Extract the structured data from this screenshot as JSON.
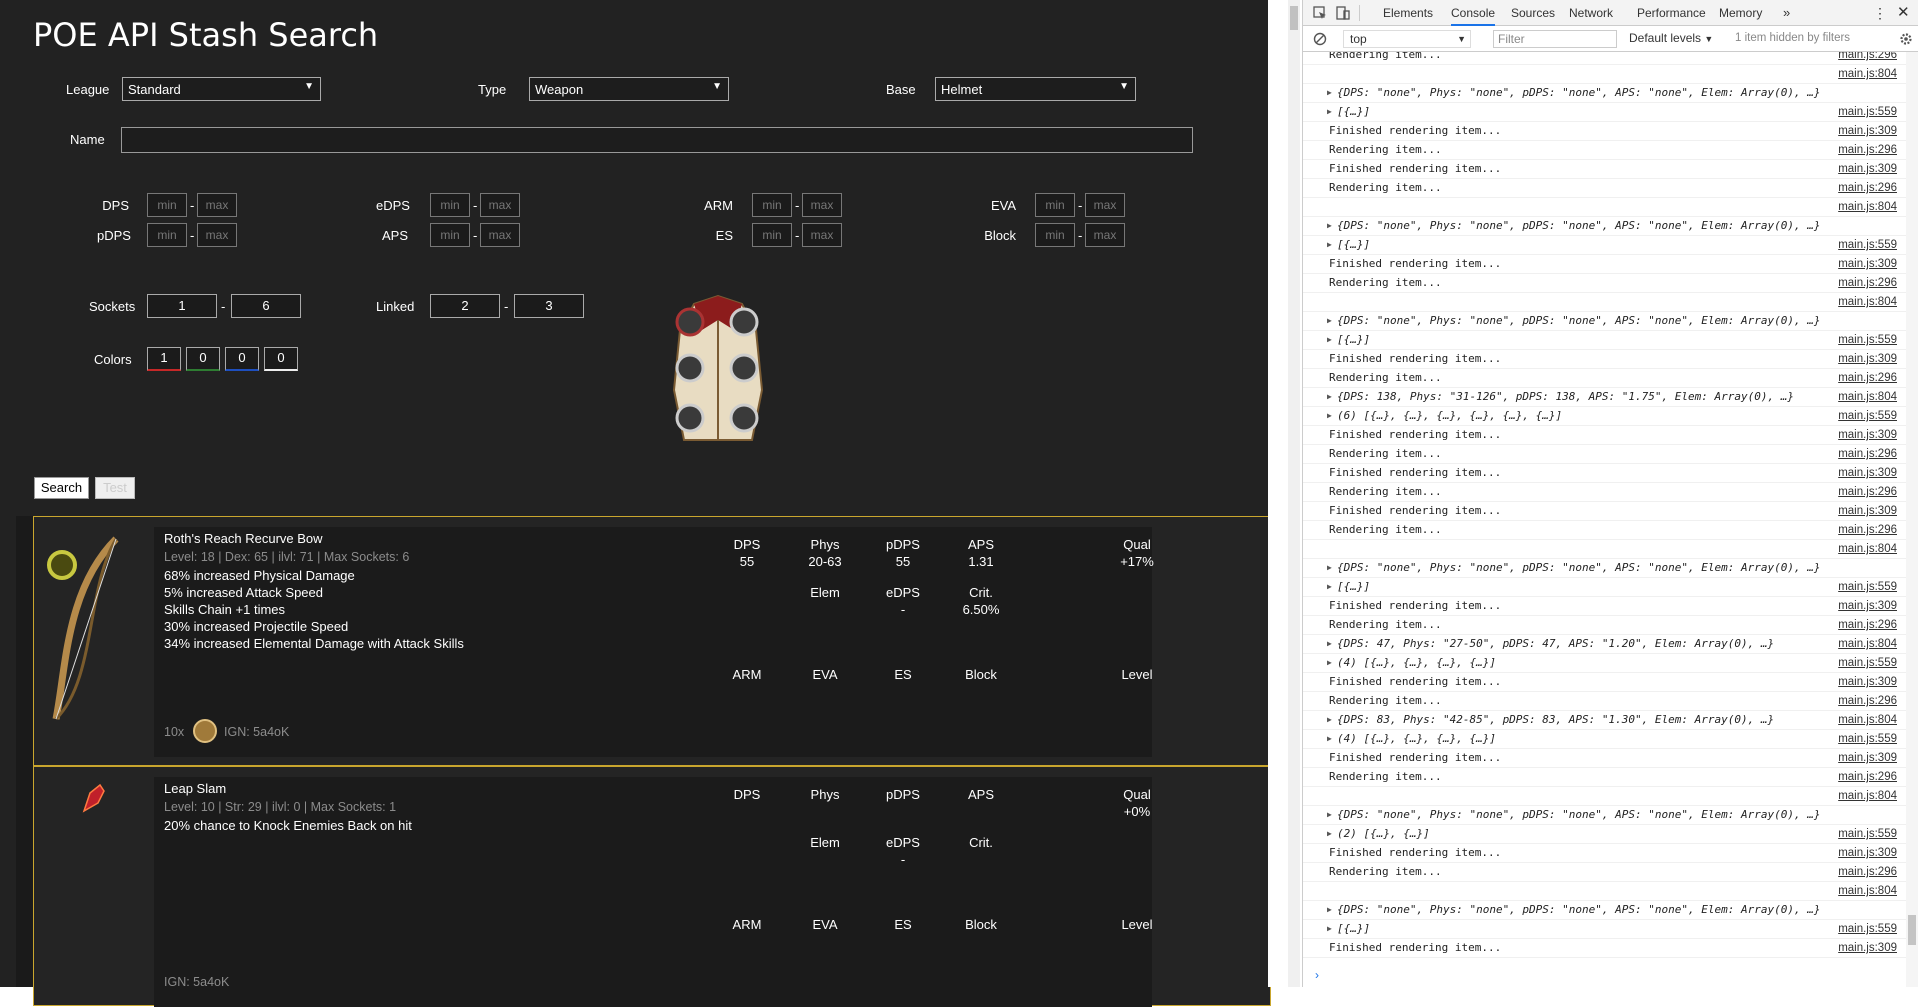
{
  "app": {
    "title": "POE API Stash Search"
  },
  "form": {
    "league_label": "League",
    "league_value": "Standard",
    "type_label": "Type",
    "type_value": "Weapon",
    "base_label": "Base",
    "base_value": "Helmet",
    "name_label": "Name",
    "min_placeholder": "min",
    "max_placeholder": "max",
    "stats_left": [
      "DPS",
      "pDPS"
    ],
    "stats_mid": [
      "eDPS",
      "APS"
    ],
    "stats_right": [
      "ARM",
      "ES"
    ],
    "stats_far": [
      "EVA",
      "Block"
    ],
    "sockets_label": "Sockets",
    "sockets_min": "1",
    "sockets_max": "6",
    "linked_label": "Linked",
    "linked_min": "2",
    "linked_max": "3",
    "colors_label": "Colors",
    "colors": [
      {
        "value": "1",
        "color": "#c62828"
      },
      {
        "value": "0",
        "color": "#2e7d32"
      },
      {
        "value": "0",
        "color": "#1e4fbf"
      },
      {
        "value": "0",
        "color": "#eeeeee"
      }
    ],
    "search_button": "Search",
    "test_button": "Test"
  },
  "results": [
    {
      "name": "Roth's Reach Recurve Bow",
      "meta": "Level: 18 | Dex: 65 | ilvl: 71 | Max Sockets: 6",
      "mods": [
        "68% increased Physical Damage",
        "5% increased Attack Speed",
        "Skills Chain +1 times",
        "30% increased Projectile Speed",
        "34% increased Elemental Damage with Attack Skills"
      ],
      "stats": {
        "dps_h": "DPS",
        "dps": "55",
        "phys_h": "Phys",
        "phys": "20-63",
        "pdps_h": "pDPS",
        "pdps": "55",
        "aps_h": "APS",
        "aps": "1.31",
        "qual_h": "Qual",
        "qual": "+17%",
        "elem_h": "Elem",
        "elem": "",
        "edps_h": "eDPS",
        "edps": "-",
        "crit_h": "Crit.",
        "crit": "6.50%",
        "arm_h": "ARM",
        "eva_h": "EVA",
        "es_h": "ES",
        "block_h": "Block",
        "level_h": "Level"
      },
      "footer_qty": "10x",
      "footer_ign": "IGN: 5a4oK"
    },
    {
      "name": "Leap Slam",
      "meta": "Level: 10 | Str: 29 | ilvl: 0 | Max Sockets: 1",
      "mods": [
        "20% chance to Knock Enemies Back on hit"
      ],
      "stats": {
        "dps_h": "DPS",
        "phys_h": "Phys",
        "pdps_h": "pDPS",
        "aps_h": "APS",
        "qual_h": "Qual",
        "qual": "+0%",
        "elem_h": "Elem",
        "edps_h": "eDPS",
        "edps": "-",
        "crit_h": "Crit.",
        "arm_h": "ARM",
        "eva_h": "EVA",
        "es_h": "ES",
        "block_h": "Block",
        "level_h": "Level"
      },
      "footer_ign": "IGN: 5a4oK"
    }
  ],
  "devtools": {
    "tabs": [
      "Elements",
      "Console",
      "Sources",
      "Network",
      "Performance",
      "Memory"
    ],
    "active_tab": "Console",
    "context": "top",
    "filter_placeholder": "Filter",
    "levels": "Default levels",
    "hidden_note": "1 item hidden by filters",
    "logs": [
      {
        "msg": "Rendering item...",
        "src": "main.js:296",
        "kind": "text"
      },
      {
        "msg": "",
        "src": "main.js:804",
        "kind": "text"
      },
      {
        "msg": "{DPS: \"none\", Phys: \"none\", pDPS: \"none\", APS: \"none\", Elem: Array(0), …}",
        "src": "",
        "kind": "obj"
      },
      {
        "msg": "[{…}]",
        "src": "main.js:559",
        "kind": "obj"
      },
      {
        "msg": "Finished rendering item...",
        "src": "main.js:309",
        "kind": "text"
      },
      {
        "msg": "Rendering item...",
        "src": "main.js:296",
        "kind": "text"
      },
      {
        "msg": "Finished rendering item...",
        "src": "main.js:309",
        "kind": "text"
      },
      {
        "msg": "Rendering item...",
        "src": "main.js:296",
        "kind": "text"
      },
      {
        "msg": "",
        "src": "main.js:804",
        "kind": "text"
      },
      {
        "msg": "{DPS: \"none\", Phys: \"none\", pDPS: \"none\", APS: \"none\", Elem: Array(0), …}",
        "src": "",
        "kind": "obj"
      },
      {
        "msg": "[{…}]",
        "src": "main.js:559",
        "kind": "obj"
      },
      {
        "msg": "Finished rendering item...",
        "src": "main.js:309",
        "kind": "text"
      },
      {
        "msg": "Rendering item...",
        "src": "main.js:296",
        "kind": "text"
      },
      {
        "msg": "",
        "src": "main.js:804",
        "kind": "text"
      },
      {
        "msg": "{DPS: \"none\", Phys: \"none\", pDPS: \"none\", APS: \"none\", Elem: Array(0), …}",
        "src": "",
        "kind": "obj"
      },
      {
        "msg": "[{…}]",
        "src": "main.js:559",
        "kind": "obj"
      },
      {
        "msg": "Finished rendering item...",
        "src": "main.js:309",
        "kind": "text"
      },
      {
        "msg": "Rendering item...",
        "src": "main.js:296",
        "kind": "text"
      },
      {
        "msg": "{DPS: 138, Phys: \"31-126\", pDPS: 138, APS: \"1.75\", Elem: Array(0), …}",
        "src": "main.js:804",
        "kind": "obj"
      },
      {
        "msg": "(6) [{…}, {…}, {…}, {…}, {…}, {…}]",
        "src": "main.js:559",
        "kind": "obj"
      },
      {
        "msg": "Finished rendering item...",
        "src": "main.js:309",
        "kind": "text"
      },
      {
        "msg": "Rendering item...",
        "src": "main.js:296",
        "kind": "text"
      },
      {
        "msg": "Finished rendering item...",
        "src": "main.js:309",
        "kind": "text"
      },
      {
        "msg": "Rendering item...",
        "src": "main.js:296",
        "kind": "text"
      },
      {
        "msg": "Finished rendering item...",
        "src": "main.js:309",
        "kind": "text"
      },
      {
        "msg": "Rendering item...",
        "src": "main.js:296",
        "kind": "text"
      },
      {
        "msg": "",
        "src": "main.js:804",
        "kind": "text"
      },
      {
        "msg": "{DPS: \"none\", Phys: \"none\", pDPS: \"none\", APS: \"none\", Elem: Array(0), …}",
        "src": "",
        "kind": "obj"
      },
      {
        "msg": "[{…}]",
        "src": "main.js:559",
        "kind": "obj"
      },
      {
        "msg": "Finished rendering item...",
        "src": "main.js:309",
        "kind": "text"
      },
      {
        "msg": "Rendering item...",
        "src": "main.js:296",
        "kind": "text"
      },
      {
        "msg": "{DPS: 47, Phys: \"27-50\", pDPS: 47, APS: \"1.20\", Elem: Array(0), …}",
        "src": "main.js:804",
        "kind": "obj"
      },
      {
        "msg": "(4) [{…}, {…}, {…}, {…}]",
        "src": "main.js:559",
        "kind": "obj"
      },
      {
        "msg": "Finished rendering item...",
        "src": "main.js:309",
        "kind": "text"
      },
      {
        "msg": "Rendering item...",
        "src": "main.js:296",
        "kind": "text"
      },
      {
        "msg": "{DPS: 83, Phys: \"42-85\", pDPS: 83, APS: \"1.30\", Elem: Array(0), …}",
        "src": "main.js:804",
        "kind": "obj"
      },
      {
        "msg": "(4) [{…}, {…}, {…}, {…}]",
        "src": "main.js:559",
        "kind": "obj"
      },
      {
        "msg": "Finished rendering item...",
        "src": "main.js:309",
        "kind": "text"
      },
      {
        "msg": "Rendering item...",
        "src": "main.js:296",
        "kind": "text"
      },
      {
        "msg": "",
        "src": "main.js:804",
        "kind": "text"
      },
      {
        "msg": "{DPS: \"none\", Phys: \"none\", pDPS: \"none\", APS: \"none\", Elem: Array(0), …}",
        "src": "",
        "kind": "obj"
      },
      {
        "msg": "(2) [{…}, {…}]",
        "src": "main.js:559",
        "kind": "obj"
      },
      {
        "msg": "Finished rendering item...",
        "src": "main.js:309",
        "kind": "text"
      },
      {
        "msg": "Rendering item...",
        "src": "main.js:296",
        "kind": "text"
      },
      {
        "msg": "",
        "src": "main.js:804",
        "kind": "text"
      },
      {
        "msg": "{DPS: \"none\", Phys: \"none\", pDPS: \"none\", APS: \"none\", Elem: Array(0), …}",
        "src": "",
        "kind": "obj"
      },
      {
        "msg": "[{…}]",
        "src": "main.js:559",
        "kind": "obj"
      },
      {
        "msg": "Finished rendering item...",
        "src": "main.js:309",
        "kind": "text"
      }
    ]
  }
}
